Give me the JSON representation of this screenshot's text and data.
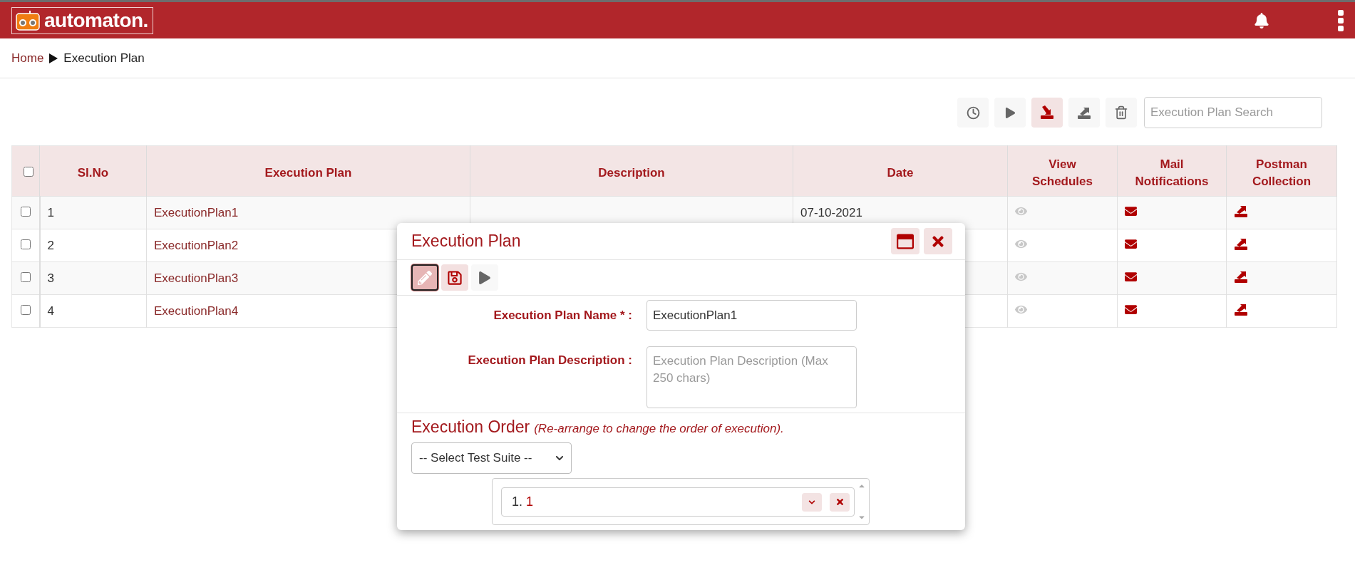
{
  "header": {
    "logo_text": "automaton."
  },
  "breadcrumb": [
    {
      "label": "Home",
      "link": true
    },
    {
      "label": "Execution Plan",
      "link": false
    }
  ],
  "toolbar": {
    "buttons": [
      {
        "kind": "schedule",
        "selected": false
      },
      {
        "kind": "run",
        "selected": false
      },
      {
        "kind": "import",
        "selected": true
      },
      {
        "kind": "export",
        "selected": false
      },
      {
        "kind": "delete",
        "selected": false
      }
    ],
    "search": {
      "placeholder": "Execution Plan Search"
    }
  },
  "table": {
    "select_all_checked": false,
    "columns": [
      "Sl.No",
      "Execution Plan",
      "Description",
      "Date",
      "View Schedules",
      "Mail Notifications",
      "Postman Collection"
    ],
    "rows": [
      {
        "checked": false,
        "sl": "1",
        "name": "ExecutionPlan1",
        "date": "07-10-2021"
      },
      {
        "checked": false,
        "sl": "2",
        "name": "ExecutionPlan2"
      },
      {
        "checked": false,
        "sl": "3",
        "name": "ExecutionPlan3"
      },
      {
        "checked": false,
        "sl": "4",
        "name": "ExecutionPlan4"
      }
    ]
  },
  "dialog": {
    "title": "Execution Plan",
    "tools": [
      {
        "kind": "edit",
        "selected": true
      },
      {
        "kind": "save",
        "selected": false
      },
      {
        "kind": "run",
        "selected": false
      }
    ],
    "name_label": "Execution Plan Name * :",
    "name_value": "ExecutionPlan1",
    "description_label": "Execution Plan Description :",
    "description_placeholder": "Execution Plan Description (Max 250 chars)",
    "order_title": "Execution Order",
    "order_note": "(Re-arrange to change the order of execution).",
    "suite_select": "-- Select Test Suite --",
    "order_items": [
      {
        "number": "1.",
        "name": "1"
      }
    ]
  }
}
